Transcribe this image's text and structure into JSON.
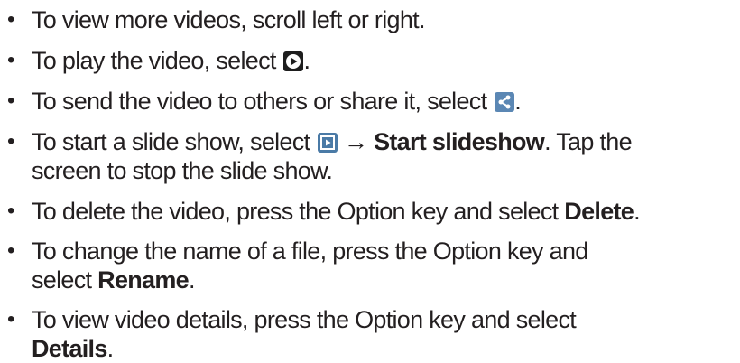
{
  "items": [
    {
      "a": "To view more videos, scroll left or right."
    },
    {
      "a": "To play the video, select ",
      "b": "."
    },
    {
      "a": "To send the video to others or share it, select ",
      "b": "."
    },
    {
      "a": "To start a slide show, select ",
      "arrow": " → ",
      "bold": "Start slideshow",
      "b": ". Tap the",
      "line2": "screen to stop the slide show."
    },
    {
      "a": "To delete the video, press the Option key and select ",
      "bold": "Delete",
      "b": "."
    },
    {
      "line1": "To change the name of a file, press the Option key and",
      "line2a": "select ",
      "bold": "Rename",
      "b": "."
    },
    {
      "line1": "To view video details, press the Option key and select",
      "bold": "Details",
      "b": "."
    }
  ],
  "bullet": "•",
  "icons": {
    "play": "play-icon",
    "share": "share-icon",
    "slideshow": "slideshow-icon"
  },
  "colors": {
    "text": "#231f20",
    "share_icon": "#5b87b4",
    "slideshow_icon": "#4a7aa6",
    "play_icon": "#1e1e1e"
  }
}
